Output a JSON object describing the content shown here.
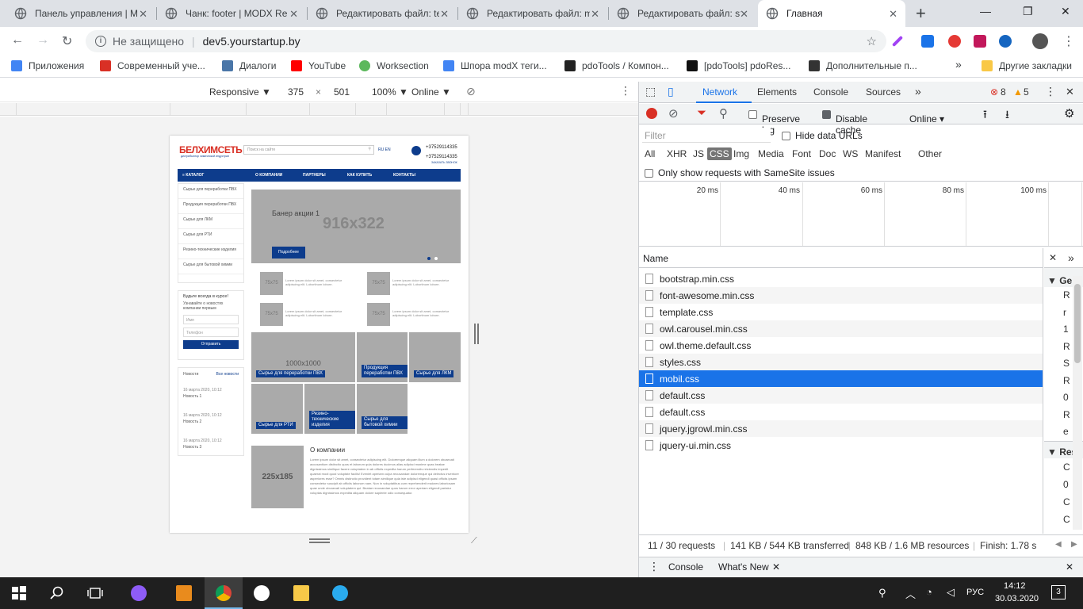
{
  "browser": {
    "tabs": [
      {
        "title": "Панель управления | M",
        "active": false
      },
      {
        "title": "Чанк: footer | MODX Re",
        "active": false
      },
      {
        "title": "Редактировать файл: te",
        "active": false
      },
      {
        "title": "Редактировать файл: m",
        "active": false
      },
      {
        "title": "Редактировать файл: st",
        "active": false
      },
      {
        "title": "Главная",
        "active": true
      }
    ],
    "new_tab": "+",
    "window_controls": {
      "minimize": "—",
      "maximize": "❐",
      "close": "✕"
    },
    "omnibox": {
      "security": "Не защищено",
      "url": "dev5.yourstartup.by"
    },
    "bookmarks": [
      {
        "label": "Приложения",
        "color": "#4285f4"
      },
      {
        "label": "Современный уче...",
        "color": "#d93025"
      },
      {
        "label": "Диалоги",
        "color": "#4a76a8"
      },
      {
        "label": "YouTube",
        "color": "#ff0000"
      },
      {
        "label": "Worksection",
        "color": "#5cb85c"
      },
      {
        "label": "Шпора modX теги...",
        "color": "#4285f4"
      },
      {
        "label": "pdoTools / Компон...",
        "color": "#222222"
      },
      {
        "label": "[pdoTools] pdoRes...",
        "color": "#111111"
      },
      {
        "label": "Дополнительные п...",
        "color": "#333333"
      }
    ],
    "bookmarks_more": "»",
    "other_bookmarks": "Другие закладки"
  },
  "device_toolbar": {
    "mode": "Responsive ▼",
    "width": "375",
    "times": "×",
    "height": "501",
    "zoom": "100% ▼",
    "network": "Online ▼"
  },
  "site": {
    "logo": "БЕЛХИМСЕТЬ",
    "logo_sub": "дистрибьютор химической индустрии",
    "search_placeholder": "Поиск на сайте",
    "lang": "RU EN",
    "phone1": "+37529114335",
    "phone2": "+37529114335",
    "callback": "ЗАКАЗАТЬ ЗВОНОК",
    "menu": [
      "≡ КАТАЛОГ",
      "О КОМПАНИИ",
      "ПАРТНЕРЫ",
      "КАК КУПИТЬ",
      "КОНТАКТЫ"
    ],
    "sidebar": [
      "Сырье для переработки ПВХ",
      "Продукция переработки ПВХ",
      "Сырье для ЛКМ",
      "Сырье для РТИ",
      "Резино-технические изделия",
      "Сырье для бытовой химии"
    ],
    "banner": {
      "title": "Банер акции 1",
      "size": "916x322",
      "button": "Подробнее"
    },
    "thumbs": [
      {
        "size": "75x75",
        "text": "Lorem ipsum dolor sit amet, consectetur adipiscing elit. Lobortinum lobore."
      },
      {
        "size": "75x75",
        "text": "Lorem ipsum dolor sit amet, consectetur adipiscing elit. Lobortinum lobore."
      },
      {
        "size": "75x75",
        "text": "Lorem ipsum dolor sit amet, consectetur adipiscing elit. Lobortinum lobore."
      },
      {
        "size": "75x75",
        "text": "Lorem ipsum dolor sit amet, consectetur adipiscing elit. Lobortinum lobore."
      }
    ],
    "tiles": [
      {
        "label": "Сырье для переработки ПВХ",
        "size": "1000x1000"
      },
      {
        "label": "Продукция переработки ПВХ",
        "size": ""
      },
      {
        "label": "Сырье для ЛКМ",
        "size": ""
      },
      {
        "label": "Сырье для РТИ",
        "size": ""
      },
      {
        "label": "Резино-технические изделия",
        "size": ""
      },
      {
        "label": "Сырье для бытовой химии",
        "size": ""
      }
    ],
    "form": {
      "title": "Будьте всегда в курсе!",
      "subtitle": "Узнавайте о новостях компании первым",
      "name_placeholder": "Имя",
      "phone_placeholder": "Телефон",
      "submit": "Отправить"
    },
    "news": {
      "title": "Новости",
      "all": "Все новости",
      "items": [
        {
          "date": "16 марта 2020, 10:12",
          "title": "Новость 1"
        },
        {
          "date": "16 марта 2020, 10:12",
          "title": "Новость 2"
        },
        {
          "date": "16 марта 2020, 10:12",
          "title": "Новость 3"
        }
      ]
    },
    "about": {
      "img_size": "225x185",
      "title": "О компании",
      "text": "Lorem ipsum dolor sit amet, consectetur adipiscing elit. Doloremque aliquam illum a dolorem obcaecati accusantium distinctio quos et laborum quia dolores ducimus alias adipisci maxime quas beatae dignissimos similique facere voluptatem in ab officiis expedita harum perferendis reiciendis impedit quaerat modi quod voluptate facilis! Eveniet aperiam culpa recusandae doloremque qui delectus inventore asperiores esse? Omnis distinctio provident totam similique quia iste adipisci eligendi quasi officiis ipsam consectetur suscipit ab officiis laborum nam. Non in voluptatibus cum reprehenderit maiores laboriosam quae unde obcaecati voluptatem qui. Beatae recusandae quos harum error aperiam eligendi pariatur voluptas dignissimos expedita aliquam dolore sapiente odio consequatur."
    }
  },
  "devtools": {
    "tabs": [
      "Network",
      "Elements",
      "Console",
      "Sources"
    ],
    "more": "»",
    "errors": "8",
    "warnings": "5",
    "toolbar": {
      "preserve_log": "Preserve log",
      "disable_cache": "Disable cache",
      "throttle": "Online"
    },
    "filter_placeholder": "Filter",
    "hide_data_urls": "Hide data URLs",
    "types": [
      "All",
      "XHR",
      "JS",
      "CSS",
      "Img",
      "Media",
      "Font",
      "Doc",
      "WS",
      "Manifest",
      "Other"
    ],
    "active_type": "CSS",
    "samesite": "Only show requests with SameSite issues",
    "timeline": [
      "20 ms",
      "40 ms",
      "60 ms",
      "80 ms",
      "100 ms"
    ],
    "name_header": "Name",
    "files": [
      "bootstrap.min.css",
      "font-awesome.min.css",
      "template.css",
      "owl.carousel.min.css",
      "owl.theme.default.css",
      "styles.css",
      "mobil.css",
      "default.css",
      "default.css",
      "jquery.jgrowl.min.css",
      "jquery-ui.min.css"
    ],
    "selected_index": 6,
    "detail": {
      "general": "▼ Gen",
      "response": "▼ Res",
      "letters": [
        "R",
        "r",
        "1",
        "R",
        "S",
        "R",
        "0",
        "R",
        "e"
      ],
      "letters2": [
        "C",
        "0",
        "C",
        "C"
      ]
    },
    "status": {
      "requests": "11 / 30 requests",
      "transferred": "141 KB / 544 KB transferred",
      "resources": "848 KB / 1.6 MB resources",
      "finish": "Finish: 1.78 s"
    },
    "drawer": {
      "console": "Console",
      "whats_new": "What's New"
    }
  },
  "taskbar": {
    "lang": "РУС",
    "time": "14:12",
    "date": "30.03.2020",
    "notifications": "3"
  }
}
